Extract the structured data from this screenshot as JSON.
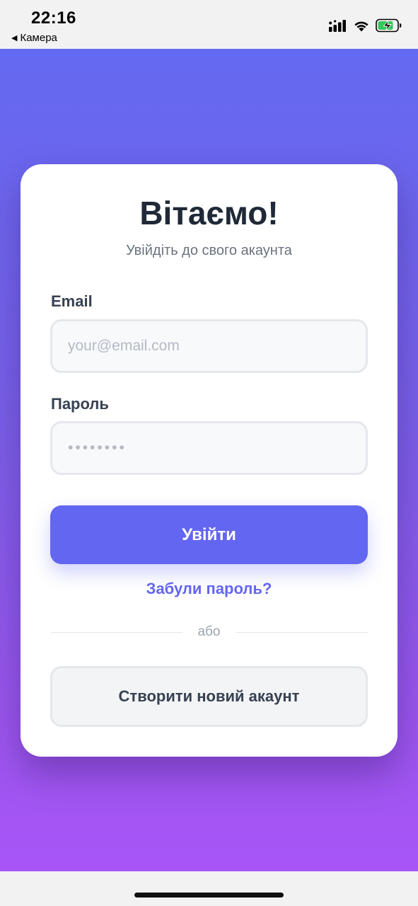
{
  "status_bar": {
    "time": "22:16",
    "back_label": "Камера",
    "back_icon": "back-triangle-icon",
    "icons": [
      "signal-icon",
      "wifi-icon",
      "battery-charging-icon"
    ]
  },
  "login": {
    "title": "Вітаємо!",
    "subtitle": "Увійдіть до свого акаунта",
    "email_label": "Email",
    "email_placeholder": "your@email.com",
    "email_value": "",
    "password_label": "Пароль",
    "password_placeholder": "••••••••",
    "password_value": "",
    "login_button": "Увійти",
    "forgot_link": "Забули пароль?",
    "divider_text": "або",
    "create_account_button": "Створити новий акаунт"
  },
  "colors": {
    "accent": "#6366f1",
    "gradient_top": "#6469f1",
    "gradient_bottom": "#a855f7",
    "card_background": "#ffffff",
    "battery_charging": "#34c759"
  }
}
